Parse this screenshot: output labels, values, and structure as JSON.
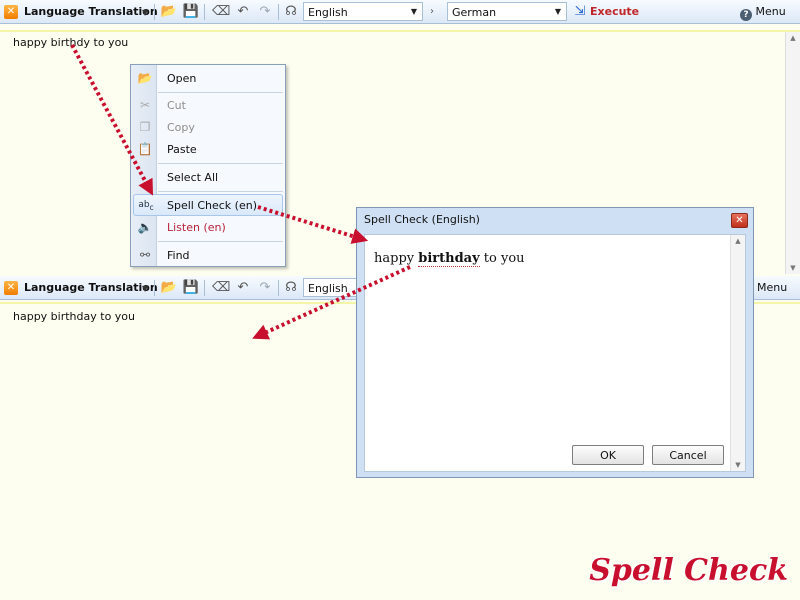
{
  "app": {
    "title": "Language Translation",
    "icon": "translation-app-icon"
  },
  "toolbar": {
    "source_language": "English",
    "target_language": "German",
    "execute_label": "Execute",
    "menu_label": "Menu",
    "icons": [
      "open-folder-icon",
      "save-icon",
      "eraser-icon",
      "undo-icon",
      "redo-icon",
      "speech-icon",
      "swap-arrow-icon",
      "execute-icon",
      "help-icon"
    ]
  },
  "top_pane": {
    "text": "happy birthdy to you"
  },
  "bottom_pane": {
    "text": "happy birthday to you",
    "source_language": "English"
  },
  "context_menu": {
    "items": [
      {
        "label": "Open",
        "icon": "open-folder-icon",
        "enabled": true
      },
      {
        "label": "Cut",
        "icon": "scissors-icon",
        "enabled": false
      },
      {
        "label": "Copy",
        "icon": "copy-icon",
        "enabled": false
      },
      {
        "label": "Paste",
        "icon": "paste-icon",
        "enabled": true
      },
      {
        "label": "Select All",
        "icon": "",
        "enabled": true
      },
      {
        "label": "Spell Check (en)",
        "icon": "spell-check-icon",
        "enabled": true,
        "highlighted": true
      },
      {
        "label": "Listen (en)",
        "icon": "speaker-icon",
        "enabled": true
      },
      {
        "label": "Find",
        "icon": "binoculars-icon",
        "enabled": true
      }
    ]
  },
  "dialog": {
    "title": "Spell Check (English)",
    "text_before": "happy ",
    "text_corrected": "birthday",
    "text_after": " to you",
    "ok_label": "OK",
    "cancel_label": "Cancel"
  },
  "caption": "Spell Check",
  "colors": {
    "accent_red": "#c8102e",
    "pane_background": "#fefef0",
    "toolbar_top": "#f7fbff",
    "toolbar_bottom": "#dce8f7"
  }
}
